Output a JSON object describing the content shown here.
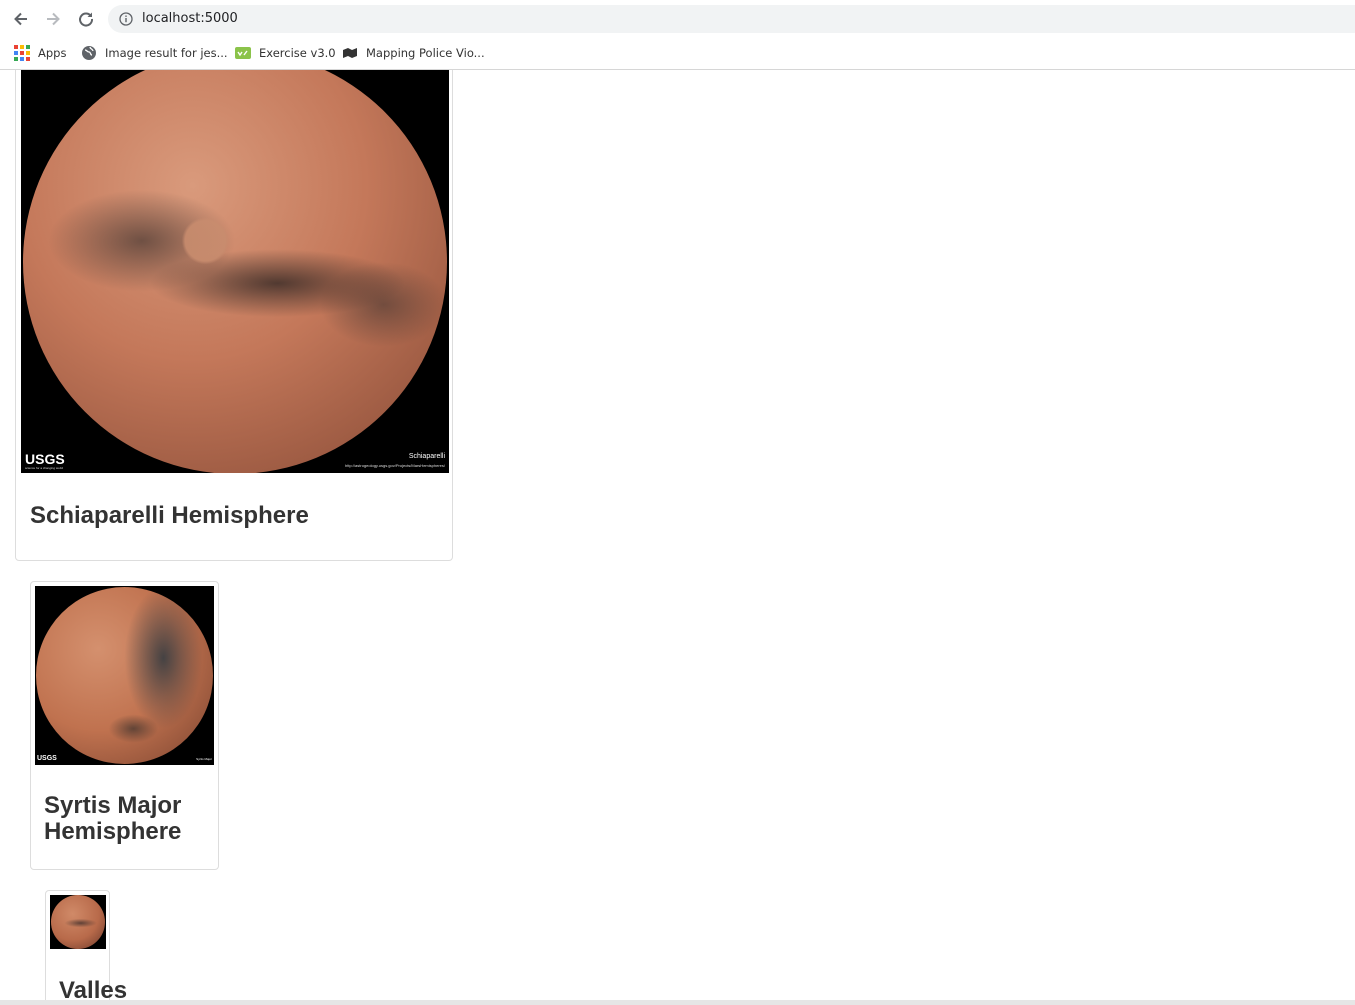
{
  "browser": {
    "url": "localhost:5000",
    "nav_icons": [
      "back-arrow-icon",
      "forward-arrow-icon",
      "reload-icon"
    ],
    "bookmarks": [
      {
        "label": "Apps",
        "icon": "apps-grid-icon"
      },
      {
        "label": "Image result for jes...",
        "icon": "globe-icon"
      },
      {
        "label": "Exercise v3.0",
        "icon": "exercise-icon"
      },
      {
        "label": "Mapping Police Vio...",
        "icon": "mapping-icon"
      }
    ]
  },
  "hemispheres": [
    {
      "title": "Schiaparelli Hemisphere",
      "image_logo": "USGS",
      "image_tagline": "science for a changing world",
      "image_caption": "Schiaparelli",
      "image_credit": "http://astrogeology.usgs.gov/Projects/MarsHemispheres/"
    },
    {
      "title": "Syrtis Major Hemisphere",
      "image_logo": "USGS",
      "image_caption": "Syrtis Major"
    },
    {
      "title": "Valles"
    }
  ],
  "colors": {
    "mars_surface": "#c4785a",
    "mars_dark": "#4a3a35",
    "card_border": "#dddddd",
    "heading": "#333333"
  }
}
